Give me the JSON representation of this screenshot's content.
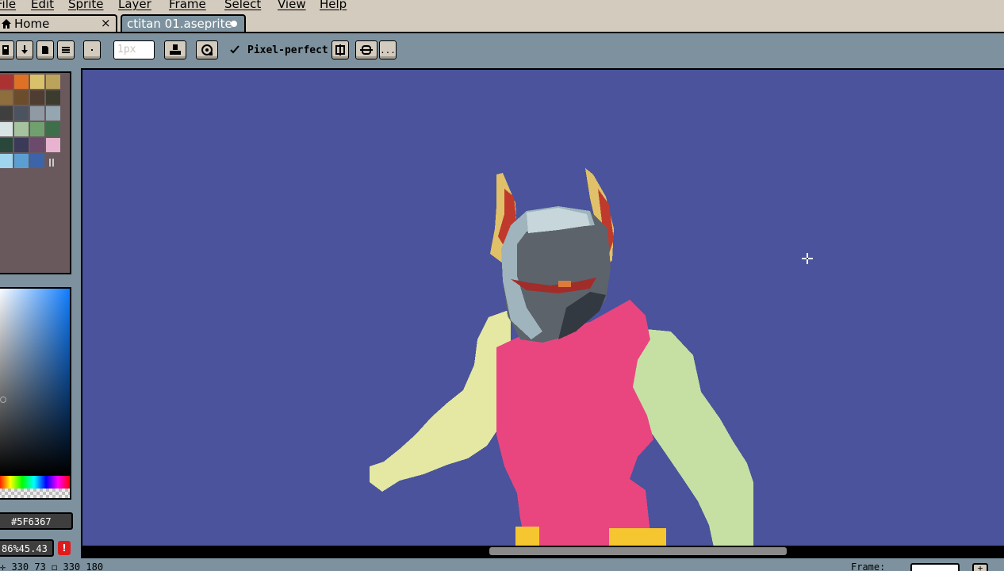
{
  "menu": {
    "items": [
      "File",
      "Edit",
      "Sprite",
      "Layer",
      "Frame",
      "Select",
      "View",
      "Help"
    ]
  },
  "tabs": {
    "home": {
      "label": "Home",
      "close": "×"
    },
    "file": {
      "label": "ctitan 01.aseprite"
    }
  },
  "toolbar": {
    "brush_size_placeholder": "1px",
    "pixel_perfect_label": "Pixel-perfect",
    "more_label": "..."
  },
  "palette": {
    "swatches": [
      "#ac3232",
      "#df7126",
      "#d9c06a",
      "#bca35b",
      "#8f6e3d",
      "#6b4d2c",
      "#4e3d30",
      "#3c3c2e",
      "#3f3f3f",
      "#4b5360",
      "#8f9aa5",
      "#94a7b1",
      "#d8e5e5",
      "#a5c39e",
      "#6fa06e",
      "#3f6e4b",
      "#29473a",
      "#3b3a58",
      "#6b4a6b",
      "#e7b3cf",
      "#9fd5ee",
      "#5b9fd2",
      "#3d64a8"
    ]
  },
  "color": {
    "hex_label": "#5F6367",
    "zoom_label": "86%45.43",
    "accent": "#0f7dff",
    "warn_symbol": "!"
  },
  "canvas": {
    "background": "#4a539b"
  },
  "status": {
    "position_text": "✛ 330 73  ◻ 330 180",
    "frame_label": "Frame:",
    "plus": "+"
  }
}
